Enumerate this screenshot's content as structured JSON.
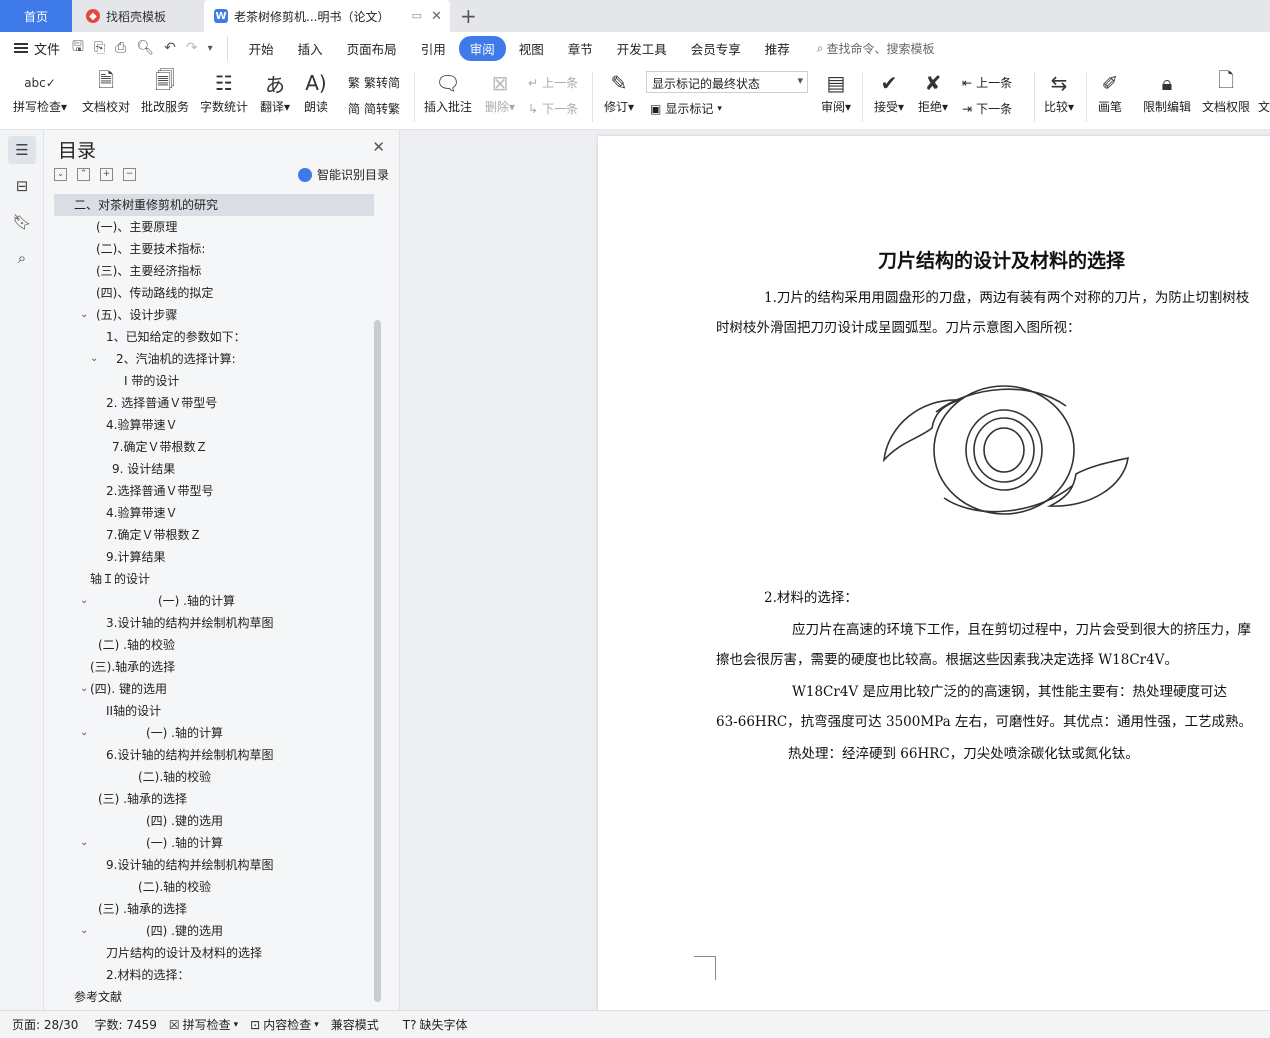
{
  "tabs": {
    "home": "首页",
    "template": "找稻壳模板",
    "document": "老茶树修剪机...明书（论文）"
  },
  "menu": {
    "file": "文件",
    "tabs": [
      "开始",
      "插入",
      "页面布局",
      "引用",
      "审阅",
      "视图",
      "章节",
      "开发工具",
      "会员专享",
      "推荐"
    ],
    "active_tab": "审阅",
    "search": "查找命令、搜索模板"
  },
  "ribbon": {
    "spell_check": "拼写检查",
    "doc_proof": "文档校对",
    "batch_service": "批改服务",
    "word_count": "字数统计",
    "translate": "翻译",
    "read_aloud": "朗读",
    "trad_conv": "繁转简",
    "simp_conv": "简转繁",
    "insert_comment": "插入批注",
    "delete": "删除",
    "prev_comment": "上一条",
    "next_comment": "下一条",
    "track_changes": "修订",
    "markup_state": "显示标记的最终状态",
    "show_markup": "显示标记",
    "review": "审阅",
    "accept": "接受",
    "reject": "拒绝",
    "prev_change": "上一条",
    "next_change": "下一条",
    "compare": "比较",
    "pen": "画笔",
    "restrict_edit": "限制编辑",
    "doc_permission": "文档权限",
    "doc_cut": "文"
  },
  "toc": {
    "title": "目录",
    "smart_toc": "智能识别目录",
    "items": [
      "二、对茶树重修剪机的研究",
      "(一)、主要原理",
      "(二)、主要技术指标:",
      "(三)、主要经济指标",
      "(四)、传动路线的拟定",
      "(五)、设计步骤",
      "1、已知给定的参数如下：",
      "2、汽油机的选择计算:",
      "I 带的设计",
      "2. 选择普通Ｖ带型号",
      "4.验算带速Ｖ",
      "7.确定Ｖ带根数Ｚ",
      "9. 设计结果",
      "2.选择普通Ｖ带型号",
      "4.验算带速Ｖ",
      "7.确定Ｖ带根数Ｚ",
      "9.计算结果",
      "轴Ｉ的设计",
      "(一) .轴的计算",
      "3.设计轴的结构并绘制机构草图",
      "(二) .轴的校验",
      "(三).轴承的选择",
      "(四). 键的选用",
      "II轴的设计",
      "(一) .轴的计算",
      "6.设计轴的结构并绘制机构草图",
      "(二).轴的校验",
      "(三) .轴承的选择",
      "(四) .键的选用",
      "(一) .轴的计算",
      "9.设计轴的结构并绘制机构草图",
      "(二).轴的校验",
      "(三) .轴承的选择",
      "(四) .键的选用",
      "刀片结构的设计及材料的选择",
      "2.材料的选择：",
      "参考文献"
    ]
  },
  "document": {
    "title": "刀片结构的设计及材料的选择",
    "p1_line1": "1.刀片的结构采用用圆盘形的刀盘，两边有装有两个对称的刀片，为防止切割树枝",
    "p1_line2": "时树枝外滑固把刀刃设计成呈圆弧型。刀片示意图入图所视：",
    "p2_heading": "2.材料的选择：",
    "p3_line1": "应刀片在高速的环境下工作，且在剪切过程中，刀片会受到很大的挤压力，摩",
    "p3_line2": "擦也会很厉害，需要的硬度也比较高。根据这些因素我决定选择 W18Cr4V。",
    "p4_line1": "W18Cr4V 是应用比较广泛的的高速钢，其性能主要有：热处理硬度可达",
    "p4_line2": "63-66HRC，抗弯强度可达 3500MPa 左右，可磨性好。其优点：通用性强，工艺成熟。",
    "p5": "热处理：经淬硬到 66HRC，刀尖处喷涂碳化钛或氮化钛。"
  },
  "status": {
    "page": "页面: 28/30",
    "words": "字数: 7459",
    "spell": "拼写检查",
    "content": "内容检查",
    "compat": "兼容模式",
    "missing_font": "缺失字体"
  }
}
